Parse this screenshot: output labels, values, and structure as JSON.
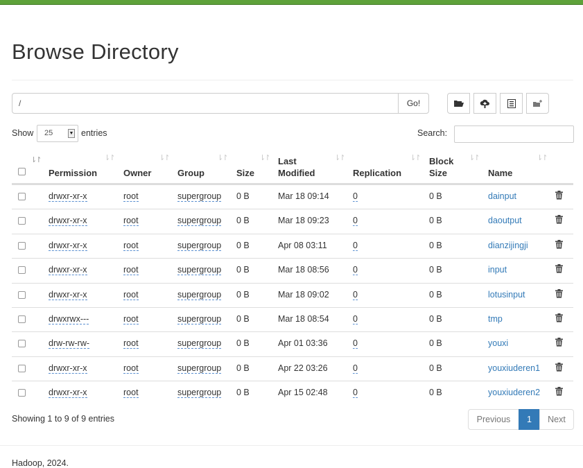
{
  "page": {
    "title": "Browse Directory",
    "footer": "Hadoop, 2024."
  },
  "toolbar": {
    "path_value": "/",
    "go_label": "Go!",
    "buttons": [
      "folder-open-icon",
      "upload-icon",
      "list-icon",
      "new-folder-icon"
    ]
  },
  "controls": {
    "show_label": "Show",
    "entries_value": "25",
    "entries_label": "entries",
    "search_label": "Search:"
  },
  "table": {
    "headers": {
      "permission": "Permission",
      "owner": "Owner",
      "group": "Group",
      "size": "Size",
      "last": "Last",
      "modified": "Modified",
      "replication": "Replication",
      "block": "Block",
      "blocksize": "Size",
      "name": "Name"
    },
    "rows": [
      {
        "permission": "drwxr-xr-x",
        "owner": "root",
        "group": "supergroup",
        "size": "0 B",
        "modified": "Mar 18 09:14",
        "replication": "0",
        "block_size": "0 B",
        "name": "dainput"
      },
      {
        "permission": "drwxr-xr-x",
        "owner": "root",
        "group": "supergroup",
        "size": "0 B",
        "modified": "Mar 18 09:23",
        "replication": "0",
        "block_size": "0 B",
        "name": "daoutput"
      },
      {
        "permission": "drwxr-xr-x",
        "owner": "root",
        "group": "supergroup",
        "size": "0 B",
        "modified": "Apr 08 03:11",
        "replication": "0",
        "block_size": "0 B",
        "name": "dianzijingji"
      },
      {
        "permission": "drwxr-xr-x",
        "owner": "root",
        "group": "supergroup",
        "size": "0 B",
        "modified": "Mar 18 08:56",
        "replication": "0",
        "block_size": "0 B",
        "name": "input"
      },
      {
        "permission": "drwxr-xr-x",
        "owner": "root",
        "group": "supergroup",
        "size": "0 B",
        "modified": "Mar 18 09:02",
        "replication": "0",
        "block_size": "0 B",
        "name": "lotusinput"
      },
      {
        "permission": "drwxrwx---",
        "owner": "root",
        "group": "supergroup",
        "size": "0 B",
        "modified": "Mar 18 08:54",
        "replication": "0",
        "block_size": "0 B",
        "name": "tmp"
      },
      {
        "permission": "drw-rw-rw-",
        "owner": "root",
        "group": "supergroup",
        "size": "0 B",
        "modified": "Apr 01 03:36",
        "replication": "0",
        "block_size": "0 B",
        "name": "youxi"
      },
      {
        "permission": "drwxr-xr-x",
        "owner": "root",
        "group": "supergroup",
        "size": "0 B",
        "modified": "Apr 22 03:26",
        "replication": "0",
        "block_size": "0 B",
        "name": "youxiuderen1"
      },
      {
        "permission": "drwxr-xr-x",
        "owner": "root",
        "group": "supergroup",
        "size": "0 B",
        "modified": "Apr 15 02:48",
        "replication": "0",
        "block_size": "0 B",
        "name": "youxiuderen2"
      }
    ]
  },
  "pagination": {
    "summary": "Showing 1 to 9 of 9 entries",
    "previous": "Previous",
    "current": "1",
    "next": "Next"
  }
}
